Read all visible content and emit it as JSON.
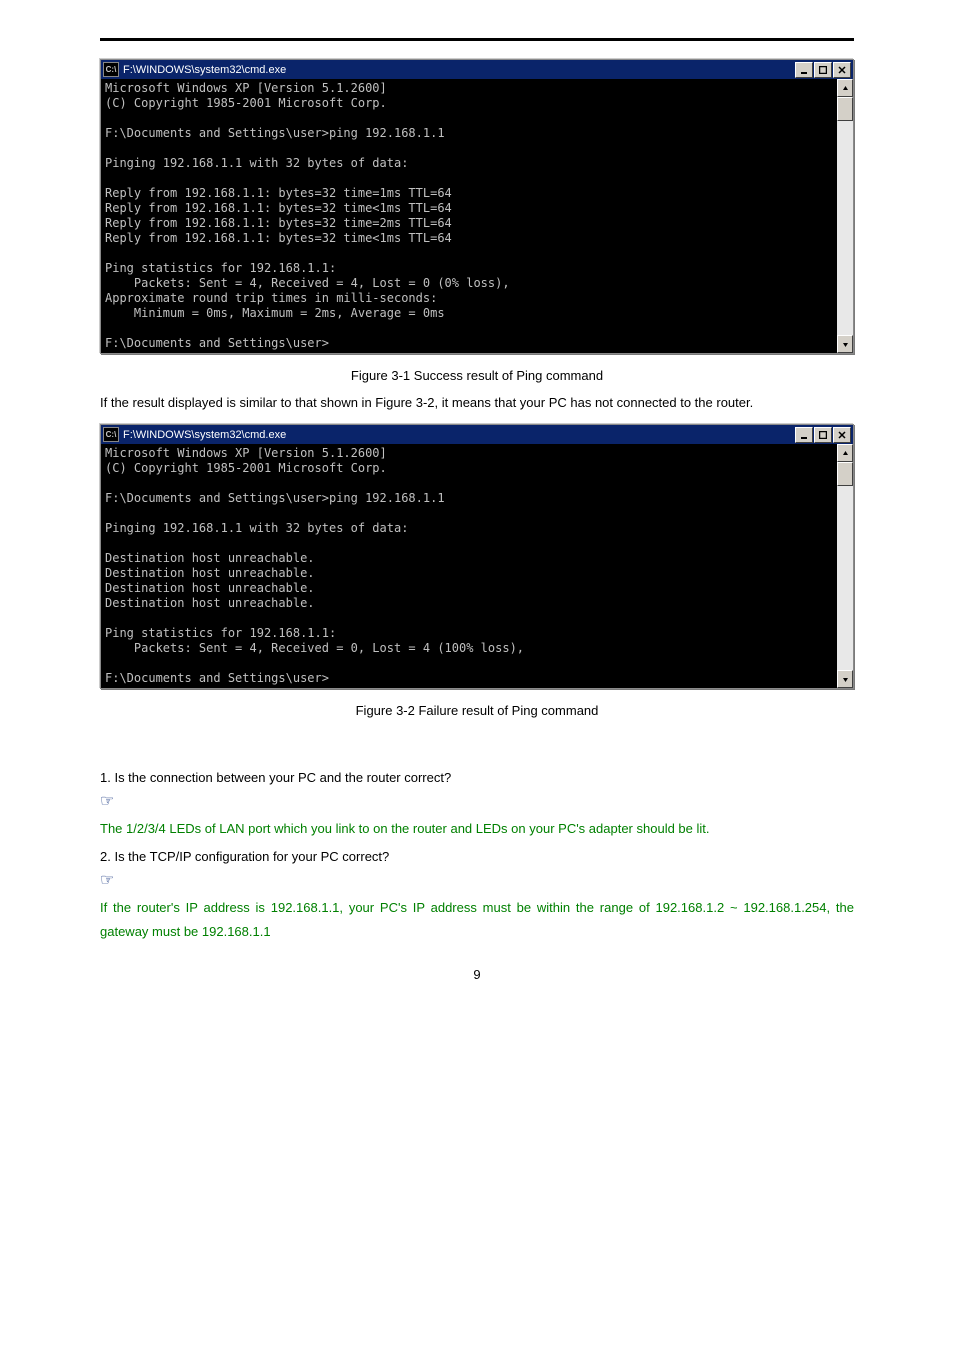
{
  "cmd1": {
    "title": "F:\\WINDOWS\\system32\\cmd.exe",
    "body": "Microsoft Windows XP [Version 5.1.2600]\n(C) Copyright 1985-2001 Microsoft Corp.\n\nF:\\Documents and Settings\\user>ping 192.168.1.1\n\nPinging 192.168.1.1 with 32 bytes of data:\n\nReply from 192.168.1.1: bytes=32 time=1ms TTL=64\nReply from 192.168.1.1: bytes=32 time<1ms TTL=64\nReply from 192.168.1.1: bytes=32 time=2ms TTL=64\nReply from 192.168.1.1: bytes=32 time<1ms TTL=64\n\nPing statistics for 192.168.1.1:\n    Packets: Sent = 4, Received = 4, Lost = 0 (0% loss),\nApproximate round trip times in milli-seconds:\n    Minimum = 0ms, Maximum = 2ms, Average = 0ms\n\nF:\\Documents and Settings\\user>"
  },
  "caption1": "Figure 3-1   Success result of Ping command",
  "para1": "If the result displayed is similar to that shown in Figure 3-2, it means that your PC has not connected to the router.",
  "cmd2": {
    "title": "F:\\WINDOWS\\system32\\cmd.exe",
    "body": "Microsoft Windows XP [Version 5.1.2600]\n(C) Copyright 1985-2001 Microsoft Corp.\n\nF:\\Documents and Settings\\user>ping 192.168.1.1\n\nPinging 192.168.1.1 with 32 bytes of data:\n\nDestination host unreachable.\nDestination host unreachable.\nDestination host unreachable.\nDestination host unreachable.\n\nPing statistics for 192.168.1.1:\n    Packets: Sent = 4, Received = 0, Lost = 4 (100% loss),\n\nF:\\Documents and Settings\\user>"
  },
  "caption2": "Figure 3-2   Failure result of Ping command",
  "q1": "1.    Is the connection between your PC and the router correct?",
  "note1": "The 1/2/3/4 LEDs of LAN port which you link to on the router and LEDs on your PC's adapter should be lit.",
  "q2": "2.    Is the TCP/IP configuration for your PC correct?",
  "note2": "If the router's IP address is 192.168.1.1, your PC's IP address must be within the range of 192.168.1.2 ~ 192.168.1.254, the gateway must be 192.168.1.1",
  "pagenum": "9",
  "icons": {
    "cmd_prefix": "C:\\"
  }
}
